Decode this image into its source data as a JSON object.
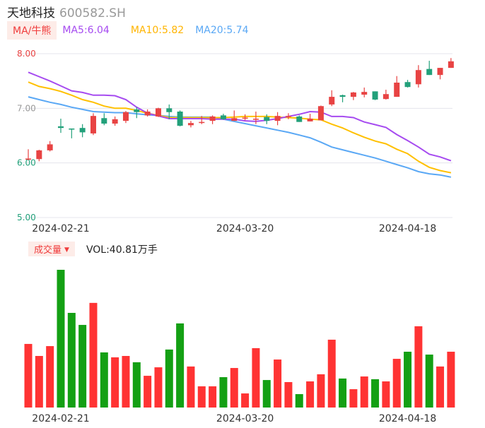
{
  "header": {
    "name": "天地科技",
    "code": "600582.SH"
  },
  "legend": {
    "badge": "MA/牛熊",
    "ma5": "MA5:6.04",
    "ma10": "MA10:5.82",
    "ma20": "MA20:5.74"
  },
  "volume_header": {
    "badge": "成交量",
    "caret": "▼",
    "value": "VOL:40.81万手"
  },
  "colors": {
    "up": "#e84343",
    "down": "#22a07a",
    "vol_up": "#ff3333",
    "vol_down": "#14a014",
    "ma5": "#a64bf0",
    "ma10": "#ffc000",
    "ma20": "#5aa8f5"
  },
  "chart_data": {
    "type": "candlestick",
    "yticks": [
      {
        "value": 8.0,
        "label": "8.00",
        "color": "#e84343"
      },
      {
        "value": 7.0,
        "label": "7.00",
        "color": "#999999"
      },
      {
        "value": 6.0,
        "label": "6.00",
        "color": "#22a07a"
      },
      {
        "value": 5.0,
        "label": "5.00",
        "color": "#22a07a"
      }
    ],
    "ylim": [
      5.0,
      8.0
    ],
    "xticks": [
      {
        "index": 3,
        "label": "2024-02-21"
      },
      {
        "index": 20,
        "label": "2024-03-20"
      },
      {
        "index": 35,
        "label": "2024-04-18"
      }
    ],
    "ohlc": [
      [
        6.06,
        6.08,
        6.25,
        6.05
      ],
      [
        6.07,
        6.23,
        6.24,
        6.03
      ],
      [
        6.23,
        6.34,
        6.4,
        6.21
      ],
      [
        6.67,
        6.64,
        6.81,
        6.55
      ],
      [
        6.63,
        6.61,
        6.63,
        6.45
      ],
      [
        6.64,
        6.56,
        6.71,
        6.47
      ],
      [
        6.54,
        6.86,
        6.91,
        6.51
      ],
      [
        6.82,
        6.72,
        6.91,
        6.69
      ],
      [
        6.72,
        6.8,
        6.85,
        6.68
      ],
      [
        6.77,
        6.93,
        6.95,
        6.73
      ],
      [
        6.98,
        6.93,
        7.02,
        6.82
      ],
      [
        6.87,
        6.94,
        6.98,
        6.85
      ],
      [
        6.85,
        7.0,
        7.01,
        6.84
      ],
      [
        7.0,
        6.93,
        7.07,
        6.8
      ],
      [
        6.94,
        6.68,
        6.96,
        6.67
      ],
      [
        6.69,
        6.73,
        6.77,
        6.65
      ],
      [
        6.74,
        6.75,
        6.86,
        6.71
      ],
      [
        6.77,
        6.85,
        6.87,
        6.71
      ],
      [
        6.87,
        6.8,
        6.9,
        6.79
      ],
      [
        6.77,
        6.82,
        6.96,
        6.77
      ],
      [
        6.81,
        6.83,
        6.89,
        6.78
      ],
      [
        6.8,
        6.81,
        6.94,
        6.71
      ],
      [
        6.84,
        6.77,
        6.89,
        6.71
      ],
      [
        6.77,
        6.86,
        6.93,
        6.69
      ],
      [
        6.85,
        6.86,
        6.91,
        6.8
      ],
      [
        6.85,
        6.75,
        6.87,
        6.75
      ],
      [
        6.76,
        6.81,
        6.9,
        6.76
      ],
      [
        6.78,
        7.04,
        7.05,
        6.78
      ],
      [
        7.07,
        7.21,
        7.33,
        7.04
      ],
      [
        7.24,
        7.21,
        7.25,
        7.11
      ],
      [
        7.21,
        7.29,
        7.3,
        7.15
      ],
      [
        7.25,
        7.3,
        7.38,
        7.2
      ],
      [
        7.31,
        7.16,
        7.31,
        7.15
      ],
      [
        7.17,
        7.26,
        7.34,
        7.16
      ],
      [
        7.21,
        7.47,
        7.59,
        7.21
      ],
      [
        7.48,
        7.39,
        7.52,
        7.38
      ],
      [
        7.44,
        7.7,
        7.79,
        7.38
      ],
      [
        7.72,
        7.61,
        7.87,
        7.61
      ],
      [
        7.61,
        7.74,
        7.74,
        7.53
      ],
      [
        7.74,
        7.86,
        7.92,
        7.74
      ]
    ],
    "ma5": [
      7.66,
      7.58,
      7.5,
      7.41,
      7.32,
      7.29,
      7.24,
      7.24,
      7.23,
      7.16,
      7.02,
      6.91,
      6.86,
      6.81,
      6.81,
      6.81,
      6.81,
      6.8,
      6.8,
      6.8,
      6.77,
      6.76,
      6.78,
      6.81,
      6.85,
      6.89,
      6.94,
      6.93,
      6.85,
      6.85,
      6.83,
      6.75,
      6.7,
      6.65,
      6.52,
      6.41,
      6.29,
      6.16,
      6.11,
      6.04
    ],
    "ma10": [
      7.48,
      7.4,
      7.36,
      7.31,
      7.24,
      7.16,
      7.11,
      7.04,
      7.0,
      7.0,
      6.96,
      6.91,
      6.87,
      6.83,
      6.83,
      6.83,
      6.83,
      6.83,
      6.83,
      6.84,
      6.85,
      6.85,
      6.85,
      6.84,
      6.83,
      6.82,
      6.8,
      6.79,
      6.71,
      6.64,
      6.55,
      6.47,
      6.4,
      6.35,
      6.25,
      6.17,
      6.03,
      5.92,
      5.86,
      5.82
    ],
    "ma20": [
      7.21,
      7.16,
      7.11,
      7.07,
      7.02,
      6.98,
      6.94,
      6.93,
      6.92,
      6.92,
      6.9,
      6.88,
      6.87,
      6.85,
      6.84,
      6.84,
      6.84,
      6.84,
      6.8,
      6.76,
      6.72,
      6.68,
      6.64,
      6.6,
      6.56,
      6.51,
      6.46,
      6.38,
      6.29,
      6.24,
      6.19,
      6.14,
      6.09,
      6.03,
      5.97,
      5.91,
      5.84,
      5.8,
      5.78,
      5.74
    ],
    "volume_unit": "万手",
    "volume": [
      46.5,
      37.7,
      44.9,
      100.7,
      69.2,
      60.4,
      76.5,
      40.3,
      36.7,
      37.7,
      33.1,
      23.2,
      29.4,
      42.4,
      61.5,
      30.0,
      15.5,
      15.5,
      22.2,
      28.9,
      10.3,
      43.4,
      20.1,
      35.1,
      18.6,
      9.8,
      19.1,
      24.3,
      49.6,
      21.2,
      13.4,
      22.7,
      20.7,
      19.1,
      35.6,
      40.8,
      59.4,
      38.7,
      30.0,
      40.81
    ]
  }
}
